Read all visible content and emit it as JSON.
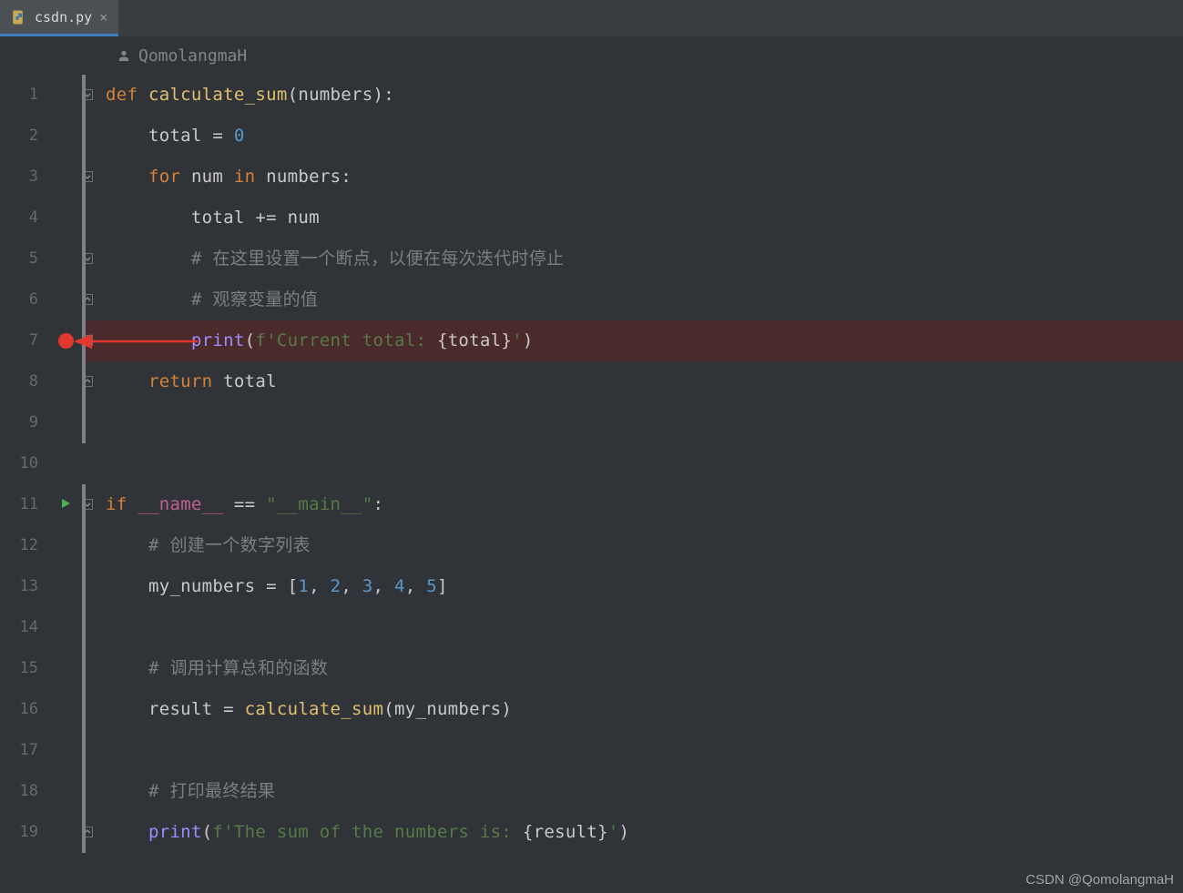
{
  "tab": {
    "filename": "csdn.py",
    "close": "×"
  },
  "author": "QomolangmaH",
  "gutter_run_line": 11,
  "breakpoint_line": 7,
  "lines": [
    {
      "n": 1,
      "fold": "down",
      "stripe": true,
      "tokens": [
        [
          "kw",
          "def "
        ],
        [
          "fn",
          "calculate_sum"
        ],
        [
          "pn",
          "("
        ],
        [
          "id",
          "numbers"
        ],
        [
          "pn",
          ")"
        ],
        [
          "pn",
          ":"
        ]
      ]
    },
    {
      "n": 2,
      "stripe": true,
      "tokens": [
        [
          "",
          "    "
        ],
        [
          "id",
          "total"
        ],
        [
          "op",
          " = "
        ],
        [
          "num",
          "0"
        ]
      ]
    },
    {
      "n": 3,
      "fold": "down",
      "stripe": true,
      "tokens": [
        [
          "",
          "    "
        ],
        [
          "kw",
          "for"
        ],
        [
          "",
          " "
        ],
        [
          "id",
          "num"
        ],
        [
          "",
          " "
        ],
        [
          "kw",
          "in"
        ],
        [
          "",
          " "
        ],
        [
          "id",
          "numbers"
        ],
        [
          "pn",
          ":"
        ]
      ]
    },
    {
      "n": 4,
      "stripe": true,
      "tokens": [
        [
          "",
          "        "
        ],
        [
          "id",
          "total"
        ],
        [
          "op",
          " += "
        ],
        [
          "id",
          "num"
        ]
      ]
    },
    {
      "n": 5,
      "fold": "down",
      "stripe": true,
      "tokens": [
        [
          "",
          "        "
        ],
        [
          "cm",
          "# 在这里设置一个断点，以便在每次迭代时停止"
        ]
      ]
    },
    {
      "n": 6,
      "fold": "up",
      "stripe": true,
      "tokens": [
        [
          "",
          "        "
        ],
        [
          "cm",
          "# 观察变量的值"
        ]
      ]
    },
    {
      "n": 7,
      "fold": "up",
      "stripe": true,
      "bp": true,
      "tokens": [
        [
          "",
          "        "
        ],
        [
          "bi",
          "print"
        ],
        [
          "pn",
          "("
        ],
        [
          "str",
          "f'Current total: "
        ],
        [
          "pn",
          "{"
        ],
        [
          "id",
          "total"
        ],
        [
          "pn",
          "}"
        ],
        [
          "str",
          "'"
        ],
        [
          "pn",
          ")"
        ]
      ]
    },
    {
      "n": 8,
      "fold": "up",
      "stripe": true,
      "tokens": [
        [
          "",
          "    "
        ],
        [
          "kw",
          "return"
        ],
        [
          "",
          " "
        ],
        [
          "id",
          "total"
        ]
      ]
    },
    {
      "n": 9,
      "stripe": true,
      "tokens": []
    },
    {
      "n": 10,
      "tokens": []
    },
    {
      "n": 11,
      "fold": "down",
      "stripe": true,
      "run": true,
      "tokens": [
        [
          "kw",
          "if"
        ],
        [
          "",
          " "
        ],
        [
          "mag",
          "__name__"
        ],
        [
          "op",
          " == "
        ],
        [
          "str",
          "\"__main__\""
        ],
        [
          "pn",
          ":"
        ]
      ]
    },
    {
      "n": 12,
      "stripe": true,
      "tokens": [
        [
          "",
          "    "
        ],
        [
          "cm",
          "# 创建一个数字列表"
        ]
      ]
    },
    {
      "n": 13,
      "stripe": true,
      "tokens": [
        [
          "",
          "    "
        ],
        [
          "id",
          "my_numbers"
        ],
        [
          "op",
          " = "
        ],
        [
          "pn",
          "["
        ],
        [
          "num",
          "1"
        ],
        [
          "op",
          ", "
        ],
        [
          "num",
          "2"
        ],
        [
          "op",
          ", "
        ],
        [
          "num",
          "3"
        ],
        [
          "op",
          ", "
        ],
        [
          "num",
          "4"
        ],
        [
          "op",
          ", "
        ],
        [
          "num",
          "5"
        ],
        [
          "pn",
          "]"
        ]
      ]
    },
    {
      "n": 14,
      "stripe": true,
      "tokens": []
    },
    {
      "n": 15,
      "stripe": true,
      "tokens": [
        [
          "",
          "    "
        ],
        [
          "cm",
          "# 调用计算总和的函数"
        ]
      ]
    },
    {
      "n": 16,
      "stripe": true,
      "tokens": [
        [
          "",
          "    "
        ],
        [
          "id",
          "result"
        ],
        [
          "op",
          " = "
        ],
        [
          "fn",
          "calculate_sum"
        ],
        [
          "pn",
          "("
        ],
        [
          "id",
          "my_numbers"
        ],
        [
          "pn",
          ")"
        ]
      ]
    },
    {
      "n": 17,
      "stripe": true,
      "tokens": []
    },
    {
      "n": 18,
      "stripe": true,
      "tokens": [
        [
          "",
          "    "
        ],
        [
          "cm",
          "# 打印最终结果"
        ]
      ]
    },
    {
      "n": 19,
      "fold": "up",
      "stripe": true,
      "tokens": [
        [
          "",
          "    "
        ],
        [
          "bi",
          "print"
        ],
        [
          "pn",
          "("
        ],
        [
          "str",
          "f'The sum of the numbers is: "
        ],
        [
          "pn",
          "{"
        ],
        [
          "id",
          "result"
        ],
        [
          "pn",
          "}"
        ],
        [
          "str",
          "'"
        ],
        [
          "pn",
          ")"
        ]
      ]
    }
  ],
  "watermark": "CSDN @QomolangmaH"
}
